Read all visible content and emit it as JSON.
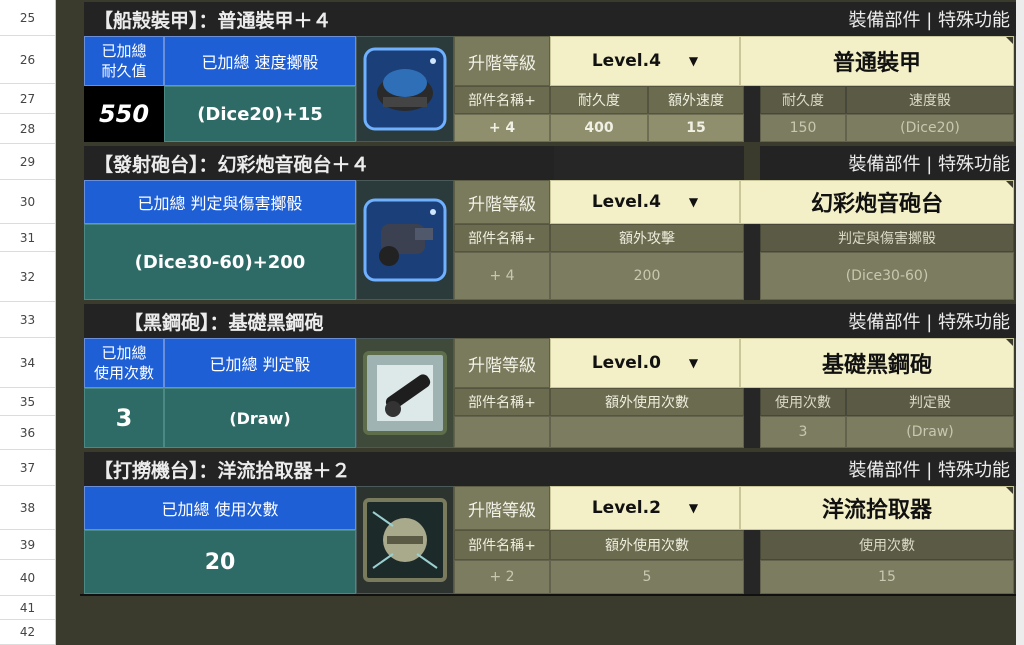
{
  "row_numbers": [
    "25",
    "26",
    "27",
    "28",
    "29",
    "30",
    "31",
    "32",
    "33",
    "34",
    "35",
    "36",
    "37",
    "38",
    "39",
    "40",
    "41",
    "42"
  ],
  "colors": {
    "header_bg": "#232323",
    "blue": "#1e5fd6",
    "teal": "#2e6b66",
    "cream": "#f3f0c8",
    "olive": "#7a7a5c"
  },
  "common": {
    "right_header": "裝備部件 | 特殊功能",
    "upgrade_label": "升階等級",
    "part_name_plus": "部件名稱+",
    "dropdown_icon": "▼"
  },
  "sections": [
    {
      "title": "【船殼裝甲】：普通裝甲＋４",
      "left_label_a": "已加總\n耐久值",
      "left_label_b": "已加總  速度擲骰",
      "left_value_a": "550",
      "left_value_b": "(Dice20)+15",
      "icon": "hull-armor-icon",
      "level": "Level.4",
      "part_name": "普通裝甲",
      "cols": [
        "耐久度",
        "額外速度"
      ],
      "vals": [
        "+ 4",
        "400",
        "15"
      ],
      "right_cols": [
        "耐久度",
        "速度骰"
      ],
      "right_vals": [
        "150",
        "(Dice20)"
      ]
    },
    {
      "title": "【發射砲台】：幻彩炮音砲台＋４",
      "left_label_b": "已加總  判定與傷害擲骰",
      "left_value_b": "(Dice30-60)+200",
      "icon": "cannon-turret-icon",
      "level": "Level.4",
      "part_name": "幻彩炮音砲台",
      "cols": [
        "額外攻擊"
      ],
      "vals": [
        "+ 4",
        "200"
      ],
      "right_cols": [
        "判定與傷害擲骰"
      ],
      "right_vals": [
        "(Dice30-60)"
      ]
    },
    {
      "title": "【黑鋼砲】：基礎黑鋼砲",
      "left_label_a": "已加總\n使用次數",
      "left_label_b": "已加總    判定骰",
      "left_value_a": "3",
      "left_value_b": "(Draw)",
      "icon": "black-steel-cannon-icon",
      "level": "Level.0",
      "part_name": "基礎黑鋼砲",
      "cols": [
        "額外使用次數"
      ],
      "vals": [
        "",
        ""
      ],
      "right_cols": [
        "使用次數",
        "判定骰"
      ],
      "right_vals": [
        "3",
        "(Draw)"
      ]
    },
    {
      "title": "【打撈機台】：洋流拾取器＋２",
      "left_label_b": "已加總  使用次數",
      "left_value_b": "20",
      "icon": "salvage-machine-icon",
      "level": "Level.2",
      "part_name": "洋流拾取器",
      "cols": [
        "額外使用次數"
      ],
      "vals": [
        "+ 2",
        "5"
      ],
      "right_cols": [
        "使用次數"
      ],
      "right_vals": [
        "15"
      ]
    }
  ]
}
